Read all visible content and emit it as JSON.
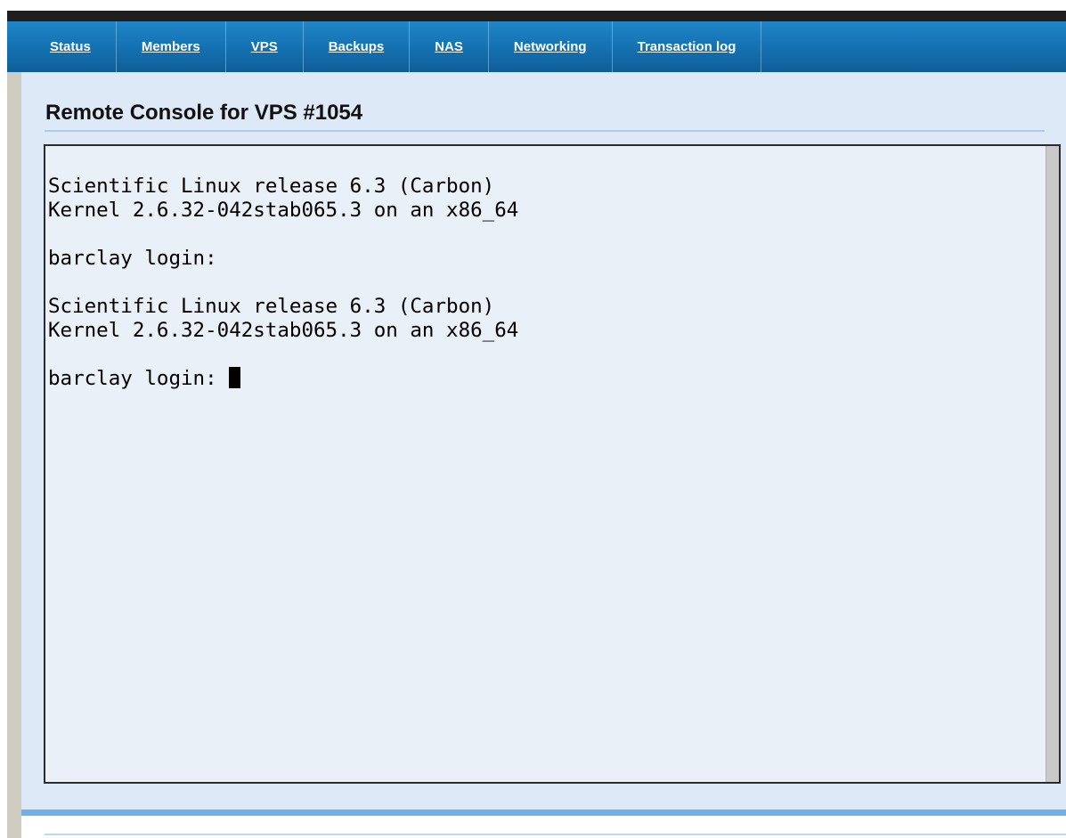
{
  "nav": {
    "items": [
      {
        "label": "Status"
      },
      {
        "label": "Members"
      },
      {
        "label": "VPS"
      },
      {
        "label": "Backups"
      },
      {
        "label": "NAS"
      },
      {
        "label": "Networking"
      },
      {
        "label": "Transaction log"
      }
    ]
  },
  "page": {
    "title": "Remote Console for VPS #1054"
  },
  "console": {
    "lines": [
      "Scientific Linux release 6.3 (Carbon)",
      "Kernel 2.6.32-042stab065.3 on an x86_64",
      "",
      "barclay login:",
      "",
      "Scientific Linux release 6.3 (Carbon)",
      "Kernel 2.6.32-042stab065.3 on an x86_64",
      "",
      "barclay login: "
    ]
  },
  "colors": {
    "nav_background": "#1470b0",
    "content_background": "#dde9f6",
    "console_background": "#e9f0f8",
    "accent_rule": "#6fb0ea"
  }
}
